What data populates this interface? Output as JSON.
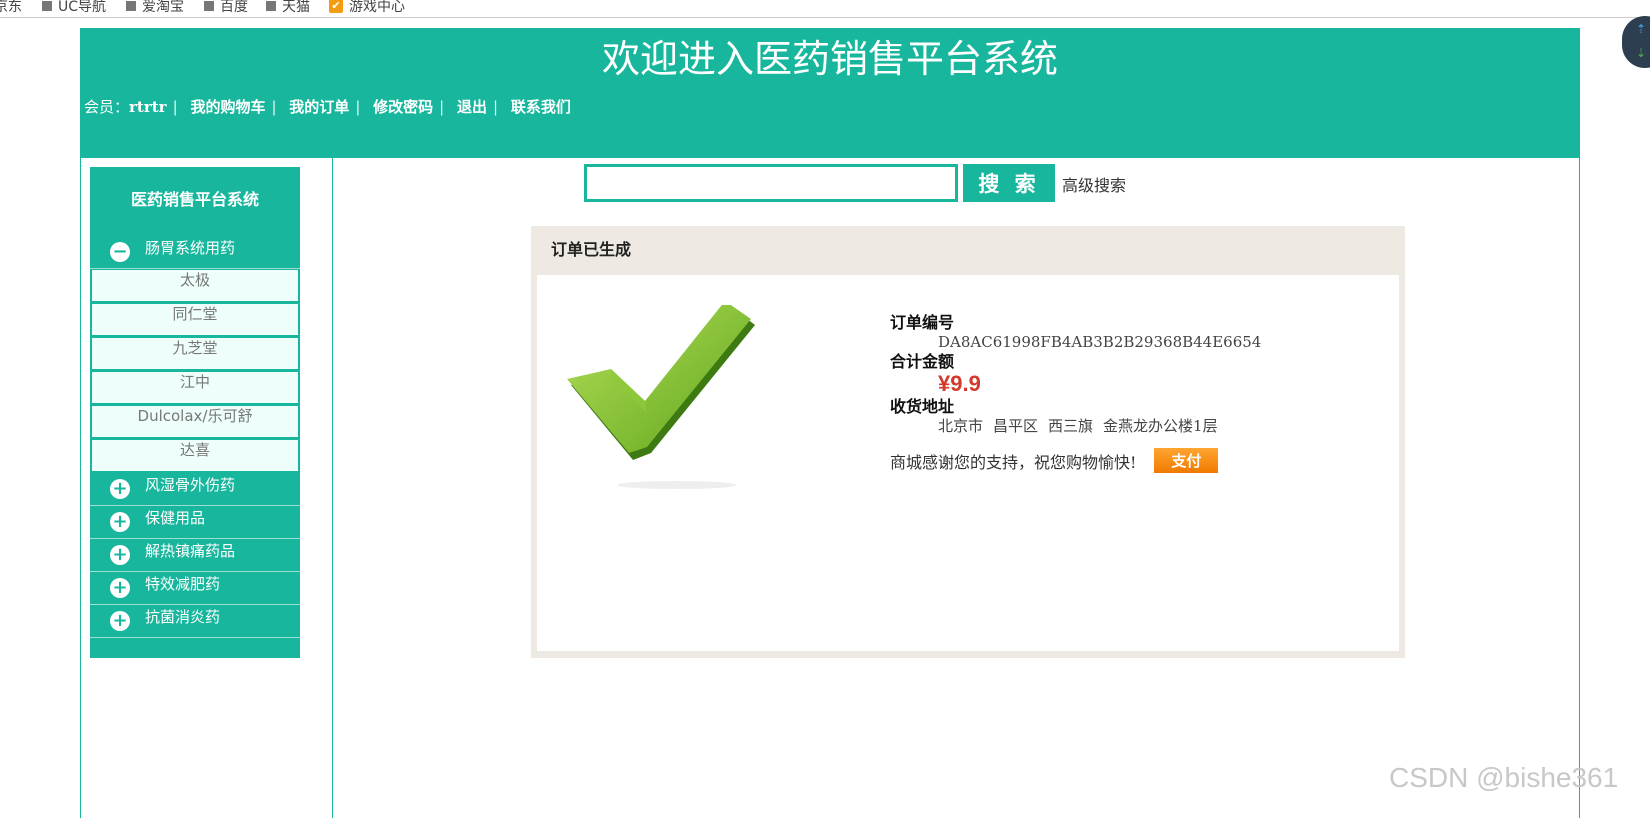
{
  "bookmarks": [
    "京东",
    "UC导航",
    "爱淘宝",
    "百度",
    "天猫",
    "游戏中心"
  ],
  "header": {
    "title": "欢迎进入医药销售平台系统",
    "member_label": "会员：",
    "username": "rtrtr",
    "nav": [
      "我的购物车",
      "我的订单",
      "修改密码",
      "退出",
      "联系我们"
    ]
  },
  "sidebar": {
    "title": "医药销售平台系统",
    "expanded_category": {
      "label": "肠胃系统用药",
      "items": [
        "太极",
        "同仁堂",
        "九芝堂",
        "江中",
        "Dulcolax/乐可舒",
        "达喜"
      ]
    },
    "collapsed_categories": [
      "风湿骨外伤药",
      "保健用品",
      "解热镇痛药品",
      "特效减肥药",
      "抗菌消炎药"
    ]
  },
  "search": {
    "placeholder": "",
    "button_label": "搜 索",
    "advanced_label": "高级搜索"
  },
  "order": {
    "panel_title": "订单已生成",
    "number_label": "订单编号",
    "number_value": "DA8AC61998FB4AB3B2B29368B44E6654",
    "amount_label": "合计金额",
    "amount_value": "¥9.9",
    "address_label": "收货地址",
    "address_parts": [
      "北京市",
      "昌平区",
      "西三旗",
      "金燕龙办公楼1层"
    ],
    "thanks_text": "商城感谢您的支持，祝您购物愉快!",
    "pay_label": "支付"
  },
  "watermark": "CSDN @bishe361",
  "colors": {
    "accent": "#18b79d",
    "price": "#d33a2c",
    "pay": "#f58a0c"
  }
}
